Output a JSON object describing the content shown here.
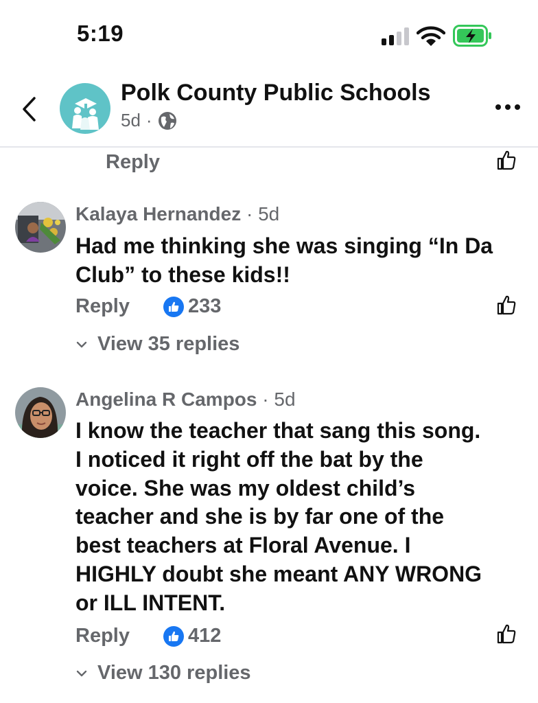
{
  "status_bar": {
    "time": "5:19",
    "battery_status": "charging",
    "battery_color": "#34c759"
  },
  "header": {
    "page_name": "Polk County Public Schools",
    "age": "5d",
    "separator": "·",
    "audience_icon": "globe-icon",
    "avatar_color": "#5fc3c7"
  },
  "top_reply": {
    "reply_label": "Reply"
  },
  "comments": [
    {
      "author": "Kalaya Hernandez",
      "sep": "·",
      "time": "5d",
      "lines": [
        "Had me thinking she was singing “In Da",
        "Club” to these kids!!"
      ],
      "reply_label": "Reply",
      "reaction_count": "233",
      "view_replies": "View 35 replies"
    },
    {
      "author": "Angelina R Campos",
      "sep": "·",
      "time": "5d",
      "lines": [
        "I know the teacher that sang this song.",
        "I noticed it right off the bat by the",
        "voice. She was my oldest child’s",
        "teacher and she is by far one of the",
        "best teachers at Floral Avenue. I",
        "HIGHLY doubt she meant ANY WRONG",
        "or ILL INTENT."
      ],
      "reply_label": "Reply",
      "reaction_count": "412",
      "view_replies": "View 130 replies"
    }
  ],
  "colors": {
    "accent": "#1877f2",
    "secondary_text": "#65676b"
  }
}
